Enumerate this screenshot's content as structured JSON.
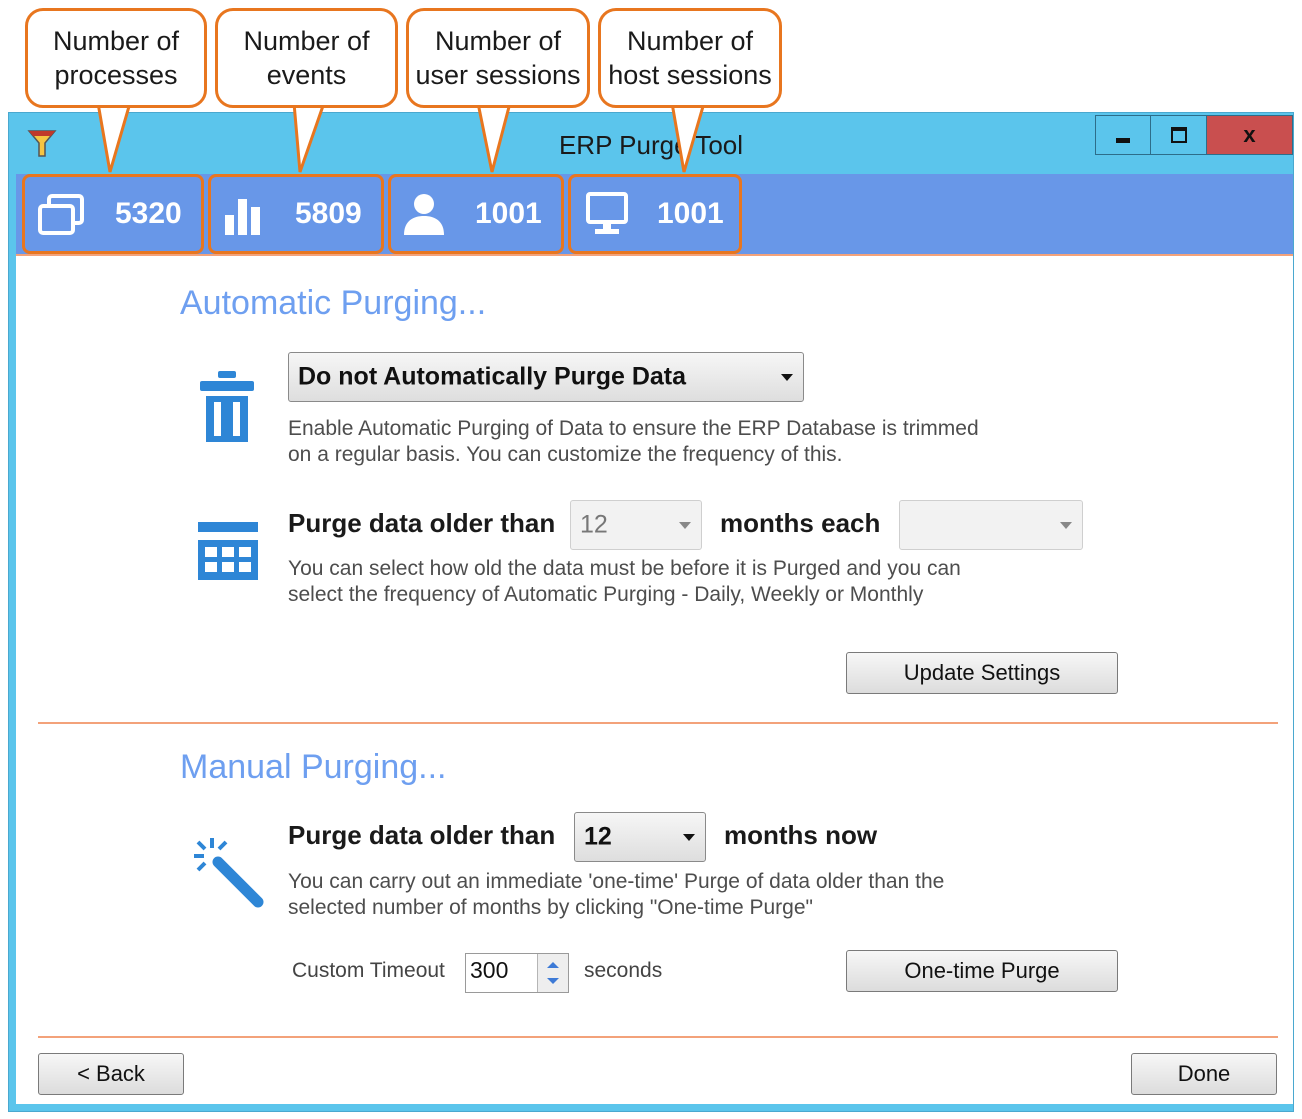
{
  "callouts": [
    {
      "line1": "Number of",
      "line2": "processes"
    },
    {
      "line1": "Number of",
      "line2": "events"
    },
    {
      "line1": "Number of",
      "line2": "user sessions"
    },
    {
      "line1": "Number of",
      "line2": "host sessions"
    }
  ],
  "window": {
    "title": "ERP Purge Tool",
    "minimize_icon": "minimize-icon",
    "maximize_icon": "maximize-icon",
    "close_label": "x",
    "colors": {
      "titlebar": "#5bc5ec",
      "statsbar": "#6897e8",
      "accent": "#e8761f",
      "heading": "#6e9ff0",
      "icon_blue": "#2e86d6",
      "close": "#c94f4f"
    }
  },
  "stats": [
    {
      "icon": "windows-icon",
      "value": "5320"
    },
    {
      "icon": "bar-chart-icon",
      "value": "5809"
    },
    {
      "icon": "user-icon",
      "value": "1001"
    },
    {
      "icon": "monitor-icon",
      "value": "1001"
    }
  ],
  "automatic": {
    "heading": "Automatic Purging...",
    "mode_icon": "trash-icon",
    "mode_value": "Do not Automatically Purge Data",
    "mode_desc_1": "Enable Automatic Purging of Data to ensure the ERP Database is trimmed",
    "mode_desc_2": "on a regular basis. You can customize the frequency of this.",
    "schedule_icon": "calendar-icon",
    "older_than_label": "Purge data older than",
    "months_value": "12",
    "months_each_label": "months each",
    "frequency_value": "",
    "schedule_desc_1": "You can select how old the data must be before it is Purged and you can",
    "schedule_desc_2": "select the frequency of Automatic Purging - Daily, Weekly or Monthly",
    "update_button": "Update Settings"
  },
  "manual": {
    "heading": "Manual Purging...",
    "icon": "magic-wand-icon",
    "older_than_label": "Purge data older than",
    "months_value": "12",
    "months_now_label": "months now",
    "desc_1": "You can carry out an immediate 'one-time' Purge of data older than the",
    "desc_2": "selected number of months by clicking \"One-time Purge\"",
    "timeout_label": "Custom Timeout",
    "timeout_value": "300",
    "seconds_label": "seconds",
    "purge_button": "One-time Purge"
  },
  "footer": {
    "back_button": "< Back",
    "done_button": "Done"
  }
}
